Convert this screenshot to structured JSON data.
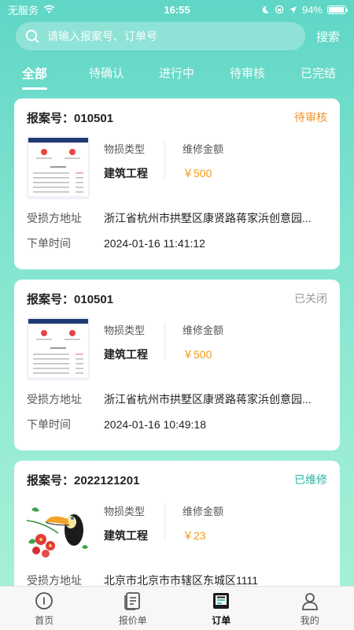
{
  "status_bar": {
    "carrier": "无服务",
    "time": "16:55",
    "battery": "94%",
    "battery_level": 0.94
  },
  "search": {
    "placeholder": "请输入报案号、订单号",
    "button_label": "搜索"
  },
  "tabs": [
    {
      "label": "全部",
      "active": true
    },
    {
      "label": "待确认",
      "active": false
    },
    {
      "label": "进行中",
      "active": false
    },
    {
      "label": "待审核",
      "active": false
    },
    {
      "label": "已完结",
      "active": false
    }
  ],
  "labels": {
    "case_no_prefix": "报案号：",
    "damage_type": "物损类型",
    "repair_amount": "维修金额",
    "address": "受损方地址",
    "order_time": "下单时间"
  },
  "orders": [
    {
      "case_no": "010501",
      "status": "待审核",
      "status_color": "#f0932b",
      "damage_type": "建筑工程",
      "amount": "￥500",
      "address": "浙江省杭州市拱墅区康贤路蒋家浜创意园...",
      "order_time": "2024-01-16 11:41:12",
      "thumb": "document"
    },
    {
      "case_no": "010501",
      "status": "已关闭",
      "status_color": "#999999",
      "damage_type": "建筑工程",
      "amount": "￥500",
      "address": "浙江省杭州市拱墅区康贤路蒋家浜创意园...",
      "order_time": "2024-01-16 10:49:18",
      "thumb": "document"
    },
    {
      "case_no": "2022121201",
      "status": "已维修",
      "status_color": "#2bb5a3",
      "damage_type": "建筑工程",
      "amount": "￥23",
      "address": "北京市北京市市辖区东城区1111",
      "order_time": "",
      "thumb": "bird"
    }
  ],
  "tabbar": [
    {
      "label": "首页",
      "icon": "home-icon",
      "active": false
    },
    {
      "label": "报价单",
      "icon": "quote-icon",
      "active": false
    },
    {
      "label": "订单",
      "icon": "order-icon",
      "active": true
    },
    {
      "label": "我的",
      "icon": "profile-icon",
      "active": false
    }
  ]
}
